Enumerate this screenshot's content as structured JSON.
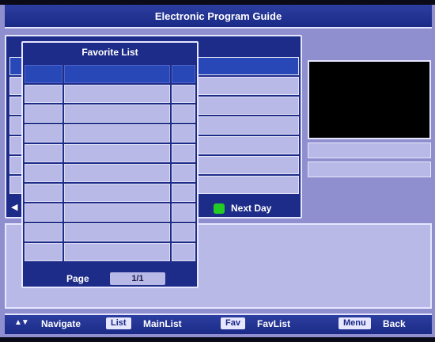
{
  "header": {
    "title": "Electronic Program Guide"
  },
  "epg": {
    "next_day_label": "Next Day",
    "row_count": 8
  },
  "favorite_list": {
    "title": "Favorite List",
    "page_label": "Page",
    "page_value": "1/1",
    "rows": 10
  },
  "help_bar": {
    "navigate_label": "Navigate",
    "list_key": "List",
    "list_label": "MainList",
    "fav_key": "Fav",
    "fav_label": "FavList",
    "menu_key": "Menu",
    "menu_label": "Back"
  },
  "icons": {
    "navigate": "up-down-arrows-icon",
    "next_day": "green-key-icon",
    "prev_day": "left-arrow-icon"
  },
  "colors": {
    "accent": "#1d2c88",
    "cell": "#b9b9e8",
    "highlight": "#2848b8",
    "green_key": "#22cc22"
  }
}
